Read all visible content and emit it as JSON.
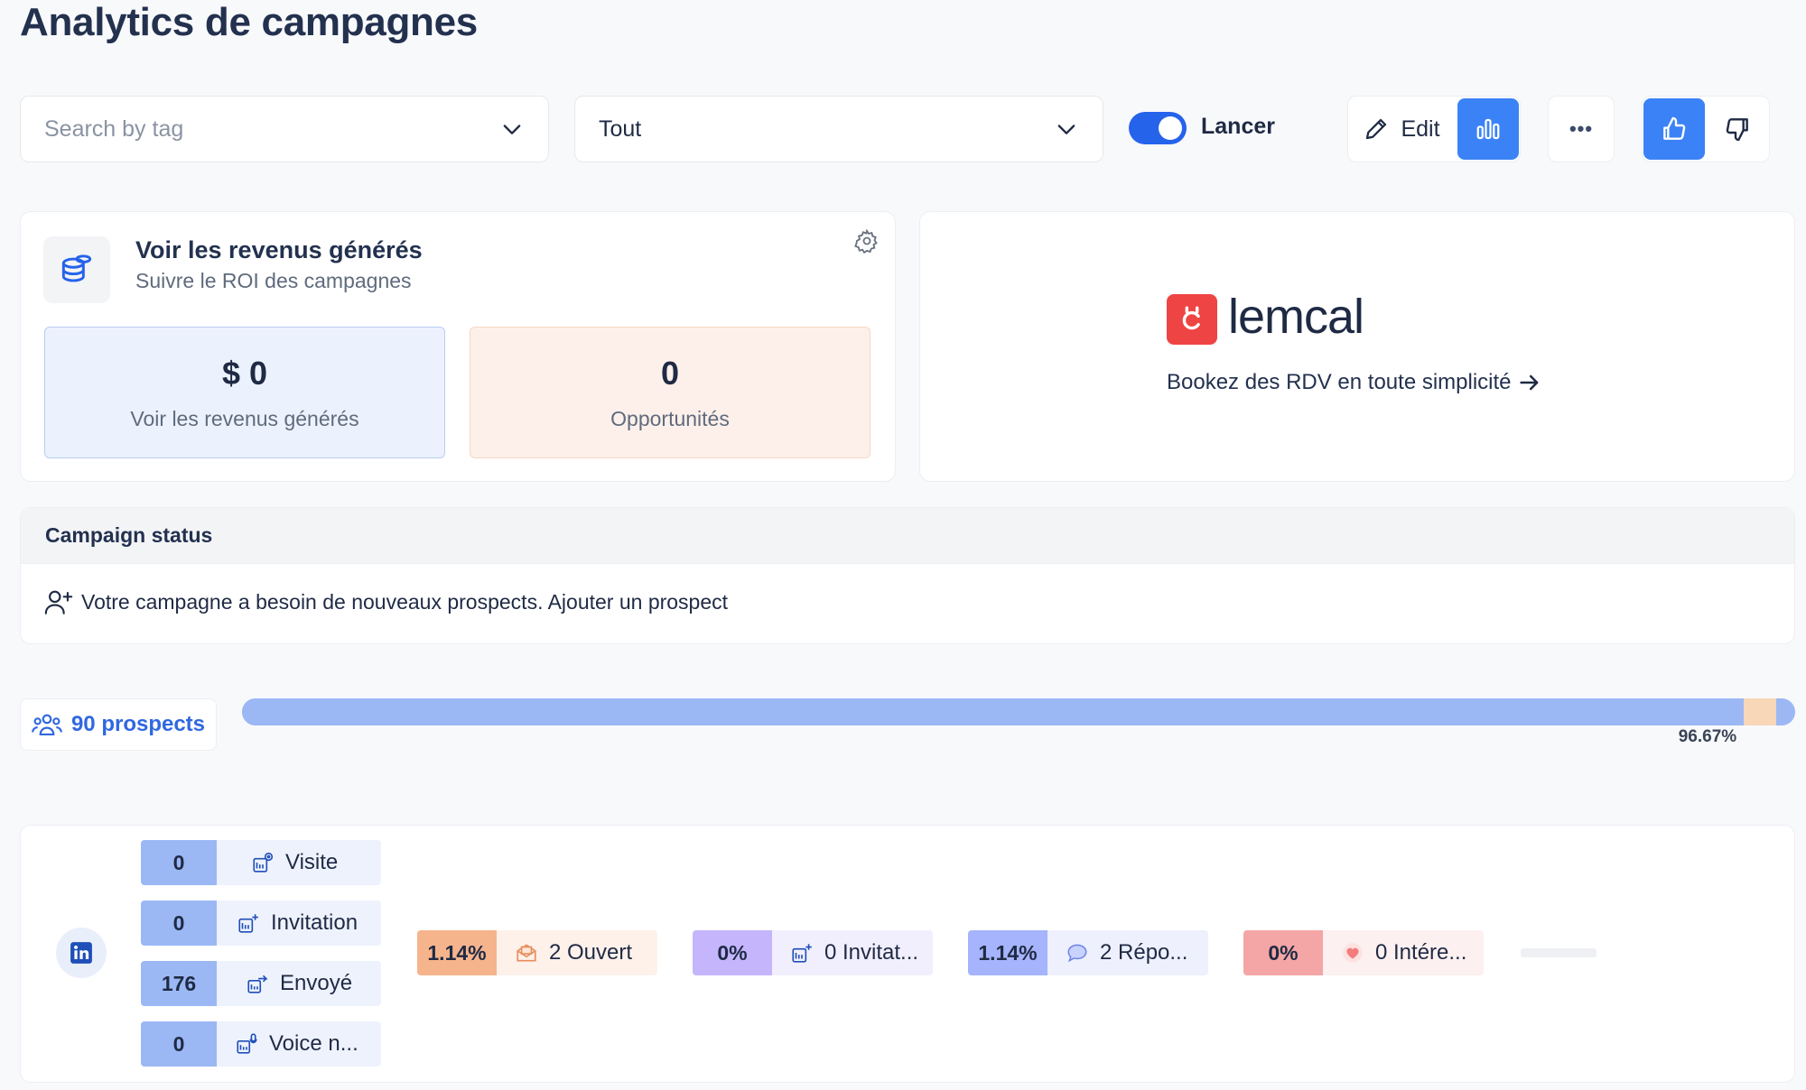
{
  "page": {
    "title": "Analytics de campagnes"
  },
  "toolbar": {
    "tag_search_placeholder": "Search by tag",
    "filter_value": "Tout",
    "toggle_label": "Lancer",
    "toggle_on": true,
    "edit_label": "Edit",
    "more_label": "•••"
  },
  "revenue": {
    "title": "Voir les revenus générés",
    "subtitle": "Suivre le ROI des campagnes",
    "revenue_value": "$ 0",
    "revenue_label": "Voir les revenus générés",
    "opportunities_value": "0",
    "opportunities_label": "Opportunités"
  },
  "lemcal": {
    "brand": "lemcal",
    "tagline": "Bookez des RDV en toute simplicité"
  },
  "status": {
    "header": "Campaign status",
    "message": "Votre campagne a besoin de nouveaux prospects. Ajouter un prospect"
  },
  "prospects": {
    "label": "90 prospects",
    "progress_fraction": 0.9667,
    "orange_fraction": 0.021,
    "progress_label": "96.67%"
  },
  "linkedin_steps": [
    {
      "count": "0",
      "label": "Visite"
    },
    {
      "count": "0",
      "label": "Invitation"
    },
    {
      "count": "176",
      "label": "Envoyé"
    },
    {
      "count": "0",
      "label": "Voice n..."
    }
  ],
  "metrics": [
    {
      "pct": "1.14%",
      "label": "2 Ouvert",
      "pct_color": "#f6b48c",
      "bg_color": "#fdf1ea"
    },
    {
      "pct": "0%",
      "label": "0 Invitat...",
      "pct_color": "#c4b5fd",
      "bg_color": "#f1effd"
    },
    {
      "pct": "1.14%",
      "label": "2 Répo...",
      "pct_color": "#a5b4fc",
      "bg_color": "#eef0fd"
    },
    {
      "pct": "0%",
      "label": "0 Intére...",
      "pct_color": "#f4a5a5",
      "bg_color": "#fdf0f0"
    }
  ],
  "colors": {
    "accent": "#3b82f6",
    "brand_red": "#ef4444",
    "linkedin": "#1f4fb8"
  }
}
